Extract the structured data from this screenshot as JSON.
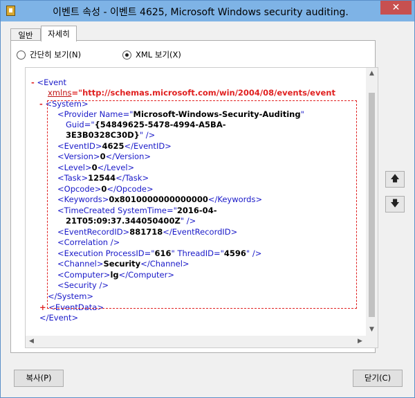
{
  "window": {
    "title": "이벤트 속성 - 이벤트 4625, Microsoft Windows security auditing.",
    "close": "✕"
  },
  "tabs": [
    {
      "label": "일반"
    },
    {
      "label": "자세히"
    }
  ],
  "view": {
    "friendly": "간단히 보기(N)",
    "xml": "XML 보기(X)",
    "selected": "xml"
  },
  "xml": {
    "event_open": "<Event",
    "xmlns_attr": "xmlns",
    "xmlns_eq": "=\"",
    "xmlns_url": "http://schemas.microsoft.com/win/2004/08/events/event",
    "system_open": "<System>",
    "provider_name_attr": "<Provider Name=\"",
    "provider_name": "Microsoft-Windows-Security-Auditing",
    "provider_name_close": "\"",
    "guid_attr": "Guid=\"",
    "guid_1": "{54849625-5478-4994-A5BA-",
    "guid_2": "3E3B0328C30D}",
    "guid_close": "\" />",
    "eventid_open": "<EventID>",
    "eventid": "4625",
    "eventid_close": "</EventID>",
    "version_open": "<Version>",
    "version": "0",
    "version_close": "</Version>",
    "level_open": "<Level>",
    "level": "0",
    "level_close": "</Level>",
    "task_open": "<Task>",
    "task": "12544",
    "task_close": "</Task>",
    "opcode_open": "<Opcode>",
    "opcode": "0",
    "opcode_close": "</Opcode>",
    "keywords_open": "<Keywords>",
    "keywords": "0x8010000000000000",
    "keywords_close": "</Keywords>",
    "timecreated_attr": "<TimeCreated SystemTime=\"",
    "timecreated_1": "2016-04-",
    "timecreated_2": "21T05:09:37.344050400Z",
    "timecreated_close": "\" />",
    "recordid_open": "<EventRecordID>",
    "recordid": "881718",
    "recordid_close": "</EventRecordID>",
    "correlation": "<Correlation />",
    "execution_attr": "<Execution ProcessID=\"",
    "process_id": "616",
    "thread_attr": "\" ThreadID=\"",
    "thread_id": "4596",
    "execution_close": "\" />",
    "channel_open": "<Channel>",
    "channel": "Security",
    "channel_close": "</Channel>",
    "computer_open": "<Computer>",
    "computer": "lg",
    "computer_close": "</Computer>",
    "security": "<Security />",
    "system_close": "</System>",
    "eventdata": "<EventData>",
    "event_close": "</Event>",
    "minus": "-",
    "plus": "+"
  },
  "scroll": {
    "up": "▲",
    "down": "▼",
    "left": "◀",
    "right": "▶"
  },
  "side": {
    "up": "🡅",
    "down": "🡇"
  },
  "buttons": {
    "copy": "복사(P)",
    "close": "닫기(C)"
  }
}
